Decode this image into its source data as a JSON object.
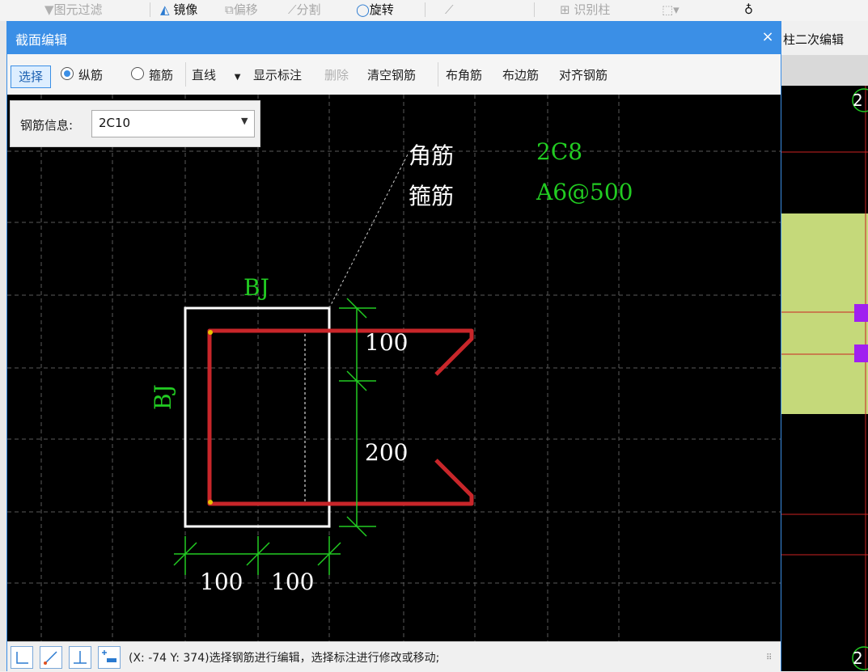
{
  "app_toolbar": {
    "element_filter": "图元过滤",
    "mirror": "镜像",
    "offset": "偏移",
    "split": "分割",
    "rotate": "旋转",
    "identify_column": "识别柱"
  },
  "background_tab": "柱二次编辑",
  "background_markers": [
    "2",
    "2"
  ],
  "dialog": {
    "title": "截面编辑",
    "close": "×",
    "toolbar": {
      "select": "选择",
      "longitudinal": "纵筋",
      "stirrup": "箍筋",
      "line_mode": "直线",
      "show_annotation": "显示标注",
      "delete": "删除",
      "clear_rebar": "清空钢筋",
      "place_corner": "布角筋",
      "place_edge": "布边筋",
      "align_rebar": "对齐钢筋"
    },
    "rebar_info": {
      "label": "钢筋信息:",
      "value": "2C10"
    }
  },
  "drawing": {
    "corner_rebar_label": "角筋",
    "corner_rebar_value": "2C8",
    "stirrup_label": "箍筋",
    "stirrup_value": "A6@500",
    "top_edge_label": "BJ",
    "left_edge_label": "BJ",
    "dim_vertical_top": "100",
    "dim_vertical_bottom": "200",
    "dim_horizontal_left": "100",
    "dim_horizontal_right": "100"
  },
  "status_bar": {
    "text": "(X: -74 Y: 374)选择钢筋进行编辑，选择标注进行修改或移动;"
  },
  "colors": {
    "title_bar": "#3b8fe6",
    "canvas_bg": "#000000",
    "dimension_green": "#22cc22",
    "rebar_red": "#cc2222",
    "outline_white": "#ffffff"
  }
}
